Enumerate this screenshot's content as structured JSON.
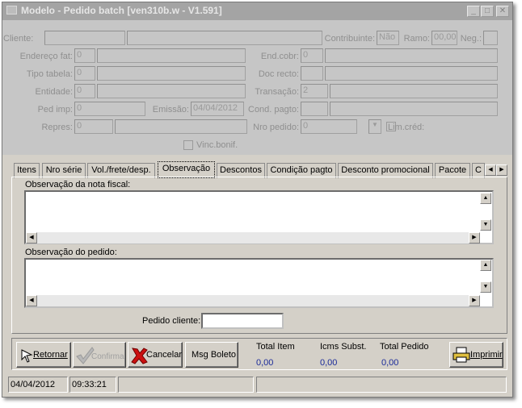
{
  "window": {
    "title": "Modelo - Pedido batch [ven310b.w - V1.591]",
    "buttons": {
      "minimize": "_",
      "maximize": "□",
      "close": "✕"
    }
  },
  "form": {
    "cliente_label": "Cliente:",
    "contribuinte_label": "Contribuinte:",
    "contribuinte_value": "Não",
    "ramo_label": "Ramo:",
    "ramo_value": "00,00",
    "neg_label": "Neg.:",
    "endereco_label": "Endereço fat:",
    "endereco_value": "0",
    "endcobr_label": "End.cobr:",
    "endcobr_value": "0",
    "tipotabela_label": "Tipo tabela:",
    "tipotabela_value": "0",
    "docrecto_label": "Doc recto:",
    "entidade_label": "Entidade:",
    "entidade_value": "0",
    "transacao_label": "Transação:",
    "transacao_value": "2",
    "pedimp_label": "Ped imp:",
    "pedimp_value": "0",
    "emissao_label": "Emissão:",
    "emissao_value": "04/04/2012",
    "condpagto_label": "Cond. pagto:",
    "repres_label": "Repres:",
    "repres_value": "0",
    "nropedido_label": "Nro pedido:",
    "nropedido_value": "0",
    "limcred_label": "Lim.créd:",
    "vincbonif_label": "Vinc.bonif."
  },
  "tabs": [
    {
      "label": "Itens"
    },
    {
      "label": "Nro série"
    },
    {
      "label": "Vol./frete/desp."
    },
    {
      "label": "Observação"
    },
    {
      "label": "Descontos"
    },
    {
      "label": "Condição pagto"
    },
    {
      "label": "Desconto promocional"
    },
    {
      "label": "Pacote"
    },
    {
      "label": "C"
    }
  ],
  "observacao": {
    "nota_label": "Observação da nota fiscal:",
    "pedido_label": "Observação do pedido:",
    "pedido_cliente_label": "Pedido cliente:"
  },
  "toolbar": {
    "retornar": "Retornar",
    "confirma": "Confirma",
    "cancelar": "Cancelar",
    "msg_boleto": "Msg Boleto",
    "imprimir": "Imprimir"
  },
  "totals": {
    "total_item_label": "Total Item",
    "total_item_value": "0,00",
    "icms_label": "Icms Subst.",
    "icms_value": "0,00",
    "total_pedido_label": "Total Pedido",
    "total_pedido_value": "0,00"
  },
  "statusbar": {
    "date": "04/04/2012",
    "time": "09:33:21"
  },
  "colors": {
    "titlebar": "#a4a4a4",
    "face": "#d4d0c8",
    "disabled_area": "#c6c6c6",
    "totals_value": "#1a2a99",
    "cancel_x": "#cc1010"
  }
}
